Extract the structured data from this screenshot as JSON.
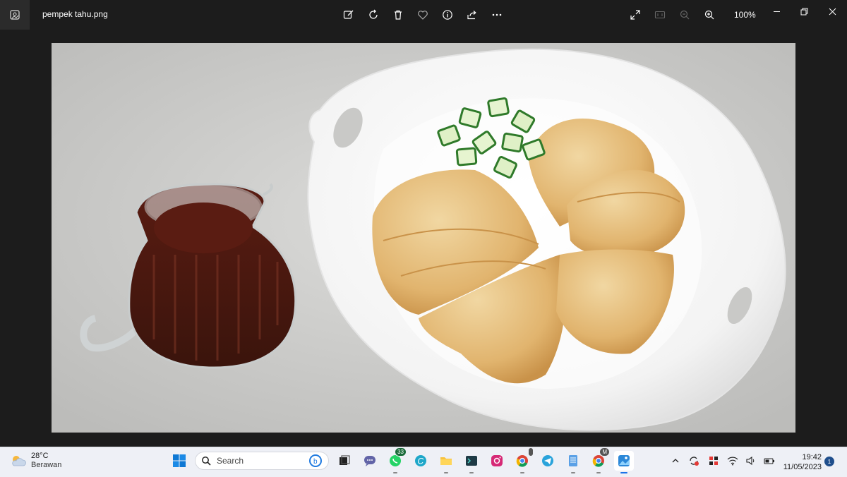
{
  "titlebar": {
    "filename": "pempek tahu.png",
    "zoom_level": "100%",
    "toolbar_icons": [
      "edit-icon",
      "rotate-icon",
      "delete-icon",
      "favorite-icon",
      "info-icon",
      "share-icon",
      "more-icon"
    ],
    "right_icons": [
      "fullscreen-icon",
      "actual-size-icon",
      "zoom-out-icon",
      "zoom-in-icon"
    ]
  },
  "photo": {
    "alt": "pempek tahu"
  },
  "taskbar": {
    "weather_temp": "28°C",
    "weather_cond": "Berawan",
    "search_placeholder": "Search",
    "whatsapp_badge": "33",
    "chrome_profile_badge": "M",
    "time": "19:42",
    "date": "11/05/2023",
    "notification_count": "1"
  }
}
